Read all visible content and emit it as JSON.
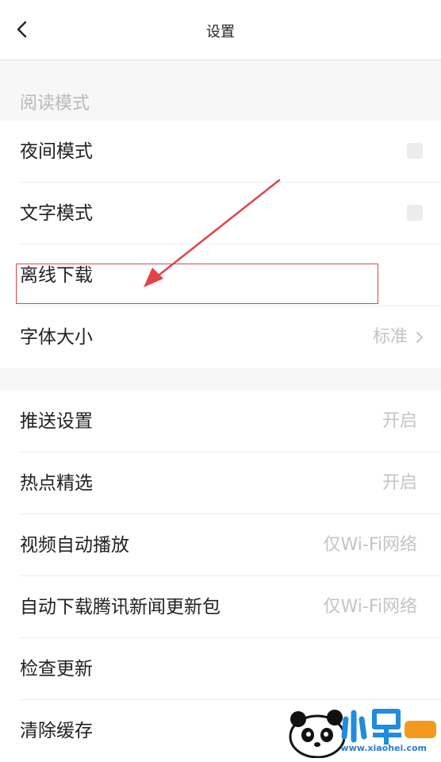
{
  "nav": {
    "title": "设置"
  },
  "reading_mode": {
    "header": "阅读模式",
    "items": [
      {
        "label": "夜间模式",
        "control": "checkbox",
        "checked": false
      },
      {
        "label": "文字模式",
        "control": "checkbox",
        "checked": false
      },
      {
        "label": "离线下载"
      },
      {
        "label": "字体大小",
        "value": "标准",
        "chevron": true
      }
    ]
  },
  "general": {
    "items": [
      {
        "label": "推送设置",
        "value": "开启"
      },
      {
        "label": "热点精选",
        "value": "开启"
      },
      {
        "label": "视频自动播放",
        "value": "仅Wi-Fi网络"
      },
      {
        "label": "自动下载腾讯新闻更新包",
        "value": "仅Wi-Fi网络"
      },
      {
        "label": "检查更新"
      },
      {
        "label": "清除缓存"
      }
    ]
  },
  "watermark": {
    "site": "www.xiaohei.com"
  },
  "colors": {
    "annotation": "#e0454a",
    "section_bg": "#f7f7f7",
    "secondary_text": "#c4c4c4",
    "watermark_blue": "#2a7fd0"
  }
}
